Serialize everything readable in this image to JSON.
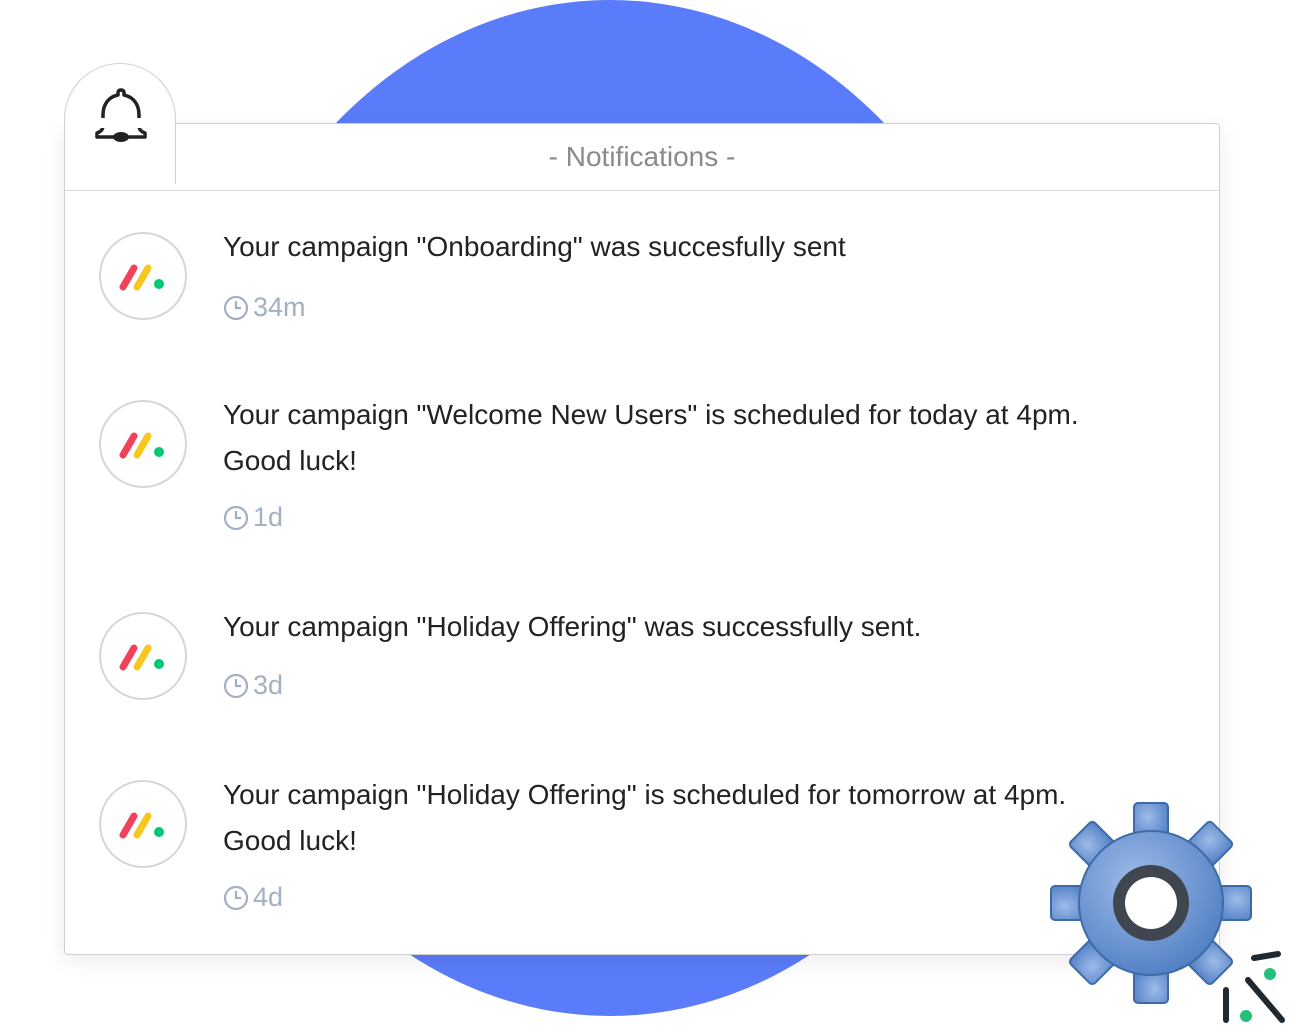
{
  "header": {
    "title": "- Notifications -"
  },
  "icons": {
    "bell": "bell-icon",
    "clock": "clock-icon",
    "gear": "gear-icon",
    "app_logo": "monday-logo-icon"
  },
  "colors": {
    "accent_blue": "#5b7cfa",
    "time_gray": "#a3afc4",
    "logo_red": "#f2425a",
    "logo_yellow": "#f7c71d",
    "logo_green": "#00c875"
  },
  "notifications": [
    {
      "message": "Your campaign \"Onboarding\" was succesfully sent",
      "time": "34m"
    },
    {
      "message": "Your campaign \"Welcome New Users\" is scheduled for today at 4pm. Good luck!",
      "time": "1d"
    },
    {
      "message": "Your campaign \"Holiday Offering\" was successfully sent.",
      "time": "3d"
    },
    {
      "message": "Your campaign \"Holiday Offering\" is scheduled for tomorrow at 4pm. Good luck!",
      "time": "4d"
    }
  ]
}
